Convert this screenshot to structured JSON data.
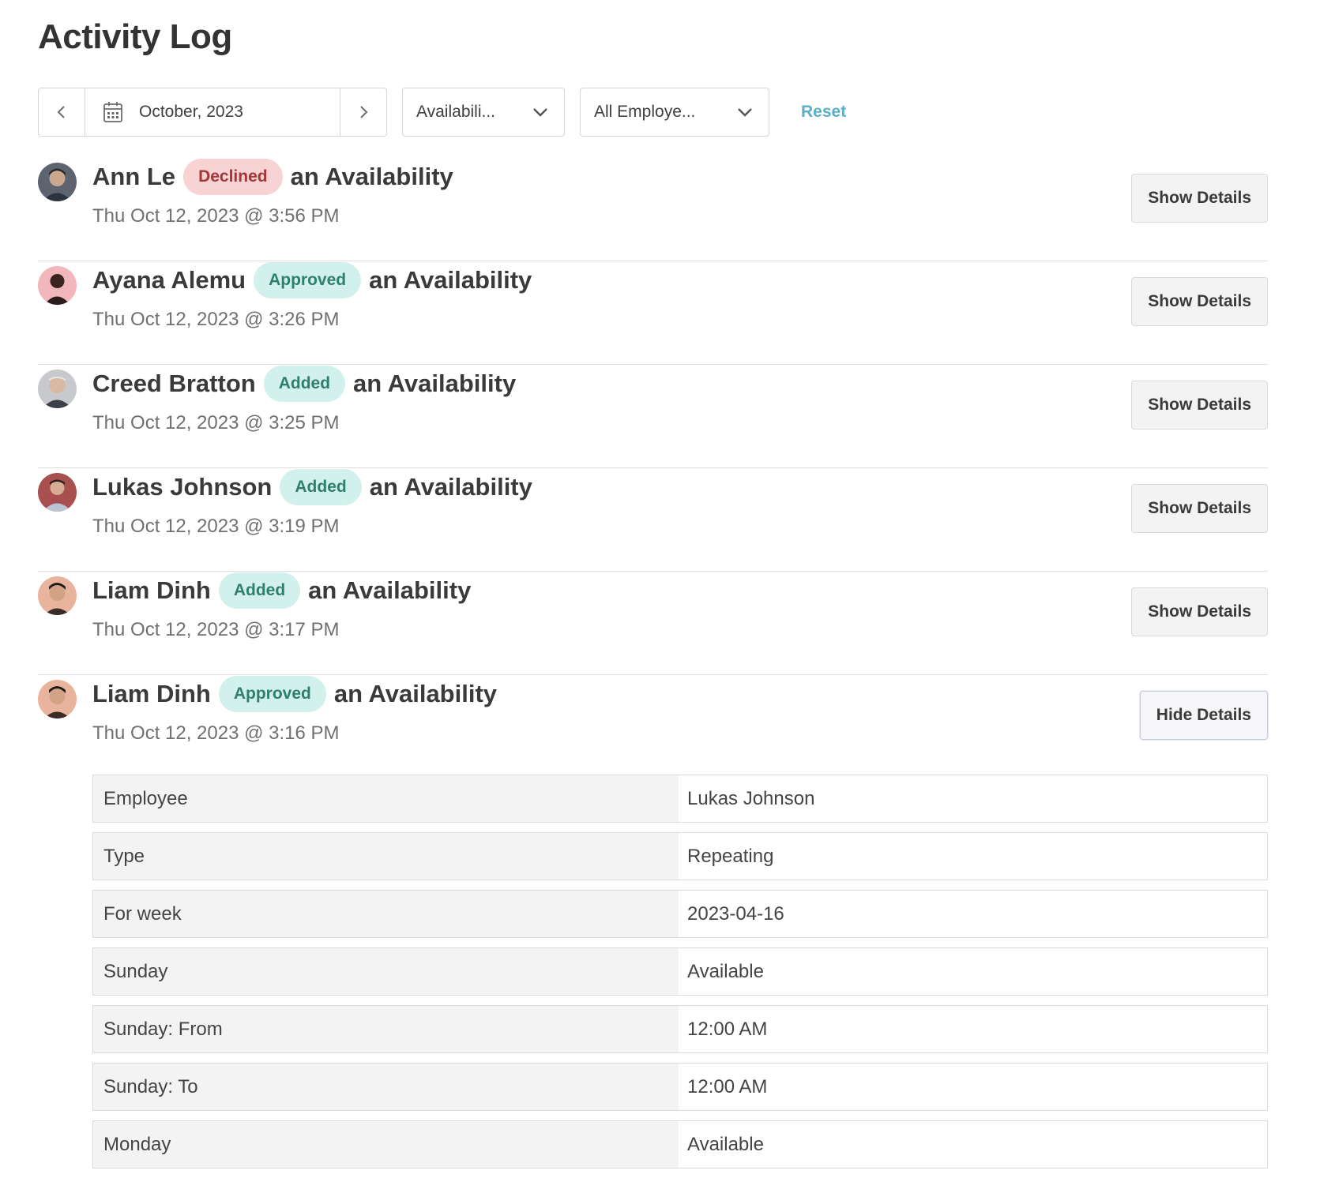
{
  "page": {
    "title": "Activity Log"
  },
  "toolbar": {
    "date_label": "October, 2023",
    "type_filter": "Availabili...",
    "employee_filter": "All Employe...",
    "reset_label": "Reset"
  },
  "activities": [
    {
      "actor": "Ann Le",
      "status": "Declined",
      "object": "an Availability",
      "timestamp": "Thu Oct 12, 2023 @ 3:56 PM",
      "button": "Show Details"
    },
    {
      "actor": "Ayana Alemu",
      "status": "Approved",
      "object": "an Availability",
      "timestamp": "Thu Oct 12, 2023 @ 3:26 PM",
      "button": "Show Details"
    },
    {
      "actor": "Creed Bratton",
      "status": "Added",
      "object": "an Availability",
      "timestamp": "Thu Oct 12, 2023 @ 3:25 PM",
      "button": "Show Details"
    },
    {
      "actor": "Lukas Johnson",
      "status": "Added",
      "object": "an Availability",
      "timestamp": "Thu Oct 12, 2023 @ 3:19 PM",
      "button": "Show Details"
    },
    {
      "actor": "Liam Dinh",
      "status": "Added",
      "object": "an Availability",
      "timestamp": "Thu Oct 12, 2023 @ 3:17 PM",
      "button": "Show Details"
    },
    {
      "actor": "Liam Dinh",
      "status": "Approved",
      "object": "an Availability",
      "timestamp": "Thu Oct 12, 2023 @ 3:16 PM",
      "button": "Hide Details"
    }
  ],
  "details": [
    {
      "key": "Employee",
      "value": "Lukas Johnson"
    },
    {
      "key": "Type",
      "value": "Repeating"
    },
    {
      "key": "For week",
      "value": "2023-04-16"
    },
    {
      "key": "Sunday",
      "value": "Available"
    },
    {
      "key": "Sunday: From",
      "value": "12:00 AM"
    },
    {
      "key": "Sunday: To",
      "value": "12:00 AM"
    },
    {
      "key": "Monday",
      "value": "Available"
    }
  ],
  "colors": {
    "accent_link": "#5ab0c8",
    "declined_bg": "#f7d3d3",
    "declined_text": "#a4353a",
    "approved_bg": "#d3f1ec",
    "approved_text": "#2e7f6d"
  },
  "icons": {
    "prev": "chevron-left-icon",
    "next": "chevron-right-icon",
    "calendar": "calendar-icon",
    "dropdown": "chevron-down-icon"
  }
}
